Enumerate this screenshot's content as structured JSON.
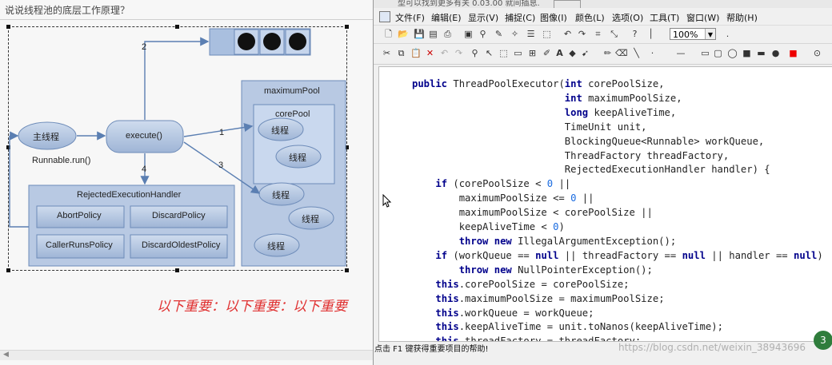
{
  "left_pane": {
    "doc_title": "说说线程池的底层工作原理？",
    "big_text": "以下重要：以下重要：以下重要"
  },
  "diagram": {
    "main_thread": "主线程",
    "runnable": "Runnable.run()",
    "execute": "execute()",
    "maximum_pool": "maximumPool",
    "core_pool": "corePool",
    "thread": "线程",
    "handler_title": "RejectedExecutionHandler",
    "policies": [
      "AbortPolicy",
      "DiscardPolicy",
      "CallerRunsPolicy",
      "DiscardOldestPolicy"
    ],
    "arrow_labels": [
      "1",
      "2",
      "3",
      "4"
    ]
  },
  "window": {
    "title_text": "型可以找到更多有关 0.03.00 就间插息.",
    "menu": [
      "文件(F)",
      "编辑(E)",
      "显示(V)",
      "捕捉(C)",
      "图像(I)",
      "颜色(L)",
      "选项(O)",
      "工具(T)",
      "窗口(W)",
      "帮助(H)"
    ],
    "zoom": "100%",
    "status": "点击 F1 键获得重要项目的帮助!",
    "watermark": "https://blog.csdn.net/weixin_38943696",
    "badge": "3"
  },
  "code_lines": [
    "public ThreadPoolExecutor(int corePoolSize,",
    "                          int maximumPoolSize,",
    "                          long keepAliveTime,",
    "                          TimeUnit unit,",
    "                          BlockingQueue<Runnable> workQueue,",
    "                          ThreadFactory threadFactory,",
    "                          RejectedExecutionHandler handler) {",
    "    if (corePoolSize < 0 ||",
    "        maximumPoolSize <= 0 ||",
    "        maximumPoolSize < corePoolSize ||",
    "        keepAliveTime < 0)",
    "        throw new IllegalArgumentException();",
    "    if (workQueue == null || threadFactory == null || handler == null)",
    "        throw new NullPointerException();",
    "    this.corePoolSize = corePoolSize;",
    "    this.maximumPoolSize = maximumPoolSize;",
    "    this.workQueue = workQueue;",
    "    this.keepAliveTime = unit.toNanos(keepAliveTime);",
    "    this.threadFactory = threadFactory;"
  ]
}
